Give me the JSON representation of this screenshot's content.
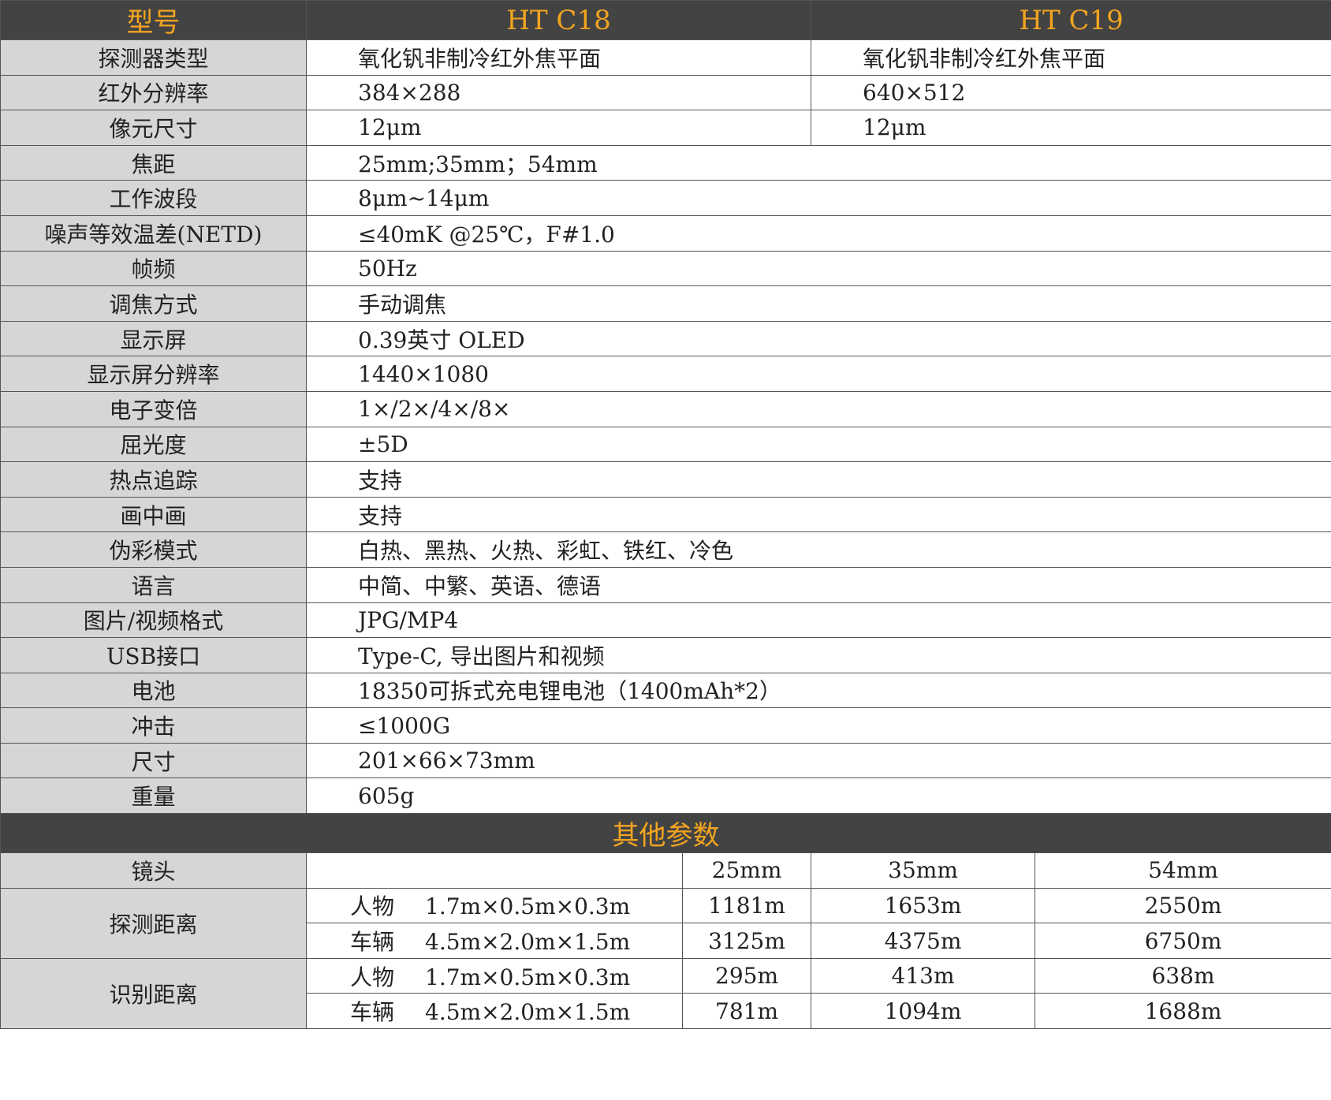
{
  "header": {
    "model_label": "型号",
    "models": [
      "HT C18",
      "HT C19"
    ]
  },
  "spec_rows_split": [
    {
      "label": "探测器类型",
      "c18": "氧化钒非制冷红外焦平面",
      "c19": "氧化钒非制冷红外焦平面"
    },
    {
      "label": "红外分辨率",
      "c18": "384×288",
      "c19": "640×512"
    },
    {
      "label": "像元尺寸",
      "c18": "12μm",
      "c19": "12μm"
    }
  ],
  "spec_rows_shared": [
    {
      "label": "焦距",
      "value": "25mm;35mm；54mm"
    },
    {
      "label": "工作波段",
      "value": "8μm~14μm"
    },
    {
      "label": "噪声等效温差(NETD)",
      "value": "≤40mK @25℃，F#1.0"
    },
    {
      "label": "帧频",
      "value": "50Hz"
    },
    {
      "label": "调焦方式",
      "value": "手动调焦"
    },
    {
      "label": "显示屏",
      "value": "0.39英寸 OLED"
    },
    {
      "label": "显示屏分辨率",
      "value": "1440×1080"
    },
    {
      "label": "电子变倍",
      "value": "1×/2×/4×/8×"
    },
    {
      "label": "屈光度",
      "value": "±5D"
    },
    {
      "label": "热点追踪",
      "value": "支持"
    },
    {
      "label": "画中画",
      "value": "支持"
    },
    {
      "label": "伪彩模式",
      "value": "白热、黑热、火热、彩虹、铁红、冷色"
    },
    {
      "label": "语言",
      "value": "中简、中繁、英语、德语"
    },
    {
      "label": "图片/视频格式",
      "value": "JPG/MP4"
    },
    {
      "label": "USB接口",
      "value": "Type-C, 导出图片和视频"
    },
    {
      "label": "电池",
      "value": "18350可拆式充电锂电池（1400mAh*2）"
    },
    {
      "label": "冲击",
      "value": "≤1000G"
    },
    {
      "label": "尺寸",
      "value": "201×66×73mm"
    },
    {
      "label": "重量",
      "value": "605g"
    }
  ],
  "other": {
    "title": "其他参数",
    "lens_label": "镜头",
    "lenses": [
      "25mm",
      "35mm",
      "54mm"
    ],
    "groups": [
      {
        "label": "探测距离",
        "rows": [
          {
            "object": "人物",
            "size": "1.7m×0.5m×0.3m",
            "values": [
              "1181m",
              "1653m",
              "2550m"
            ]
          },
          {
            "object": "车辆",
            "size": "4.5m×2.0m×1.5m",
            "values": [
              "3125m",
              "4375m",
              "6750m"
            ]
          }
        ]
      },
      {
        "label": "识别距离",
        "rows": [
          {
            "object": "人物",
            "size": "1.7m×0.5m×0.3m",
            "values": [
              "295m",
              "413m",
              "638m"
            ]
          },
          {
            "object": "车辆",
            "size": "4.5m×2.0m×1.5m",
            "values": [
              "781m",
              "1094m",
              "1688m"
            ]
          }
        ]
      }
    ]
  }
}
